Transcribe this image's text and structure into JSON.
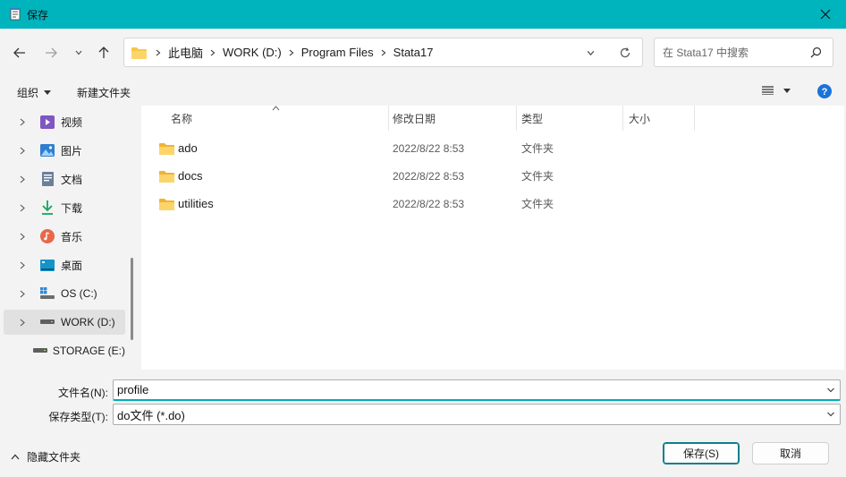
{
  "window": {
    "title": "保存"
  },
  "address": {
    "crumbs": [
      "此电脑",
      "WORK (D:)",
      "Program Files",
      "Stata17"
    ]
  },
  "search": {
    "placeholder": "在 Stata17 中搜索"
  },
  "toolbar": {
    "organize": "组织",
    "new_folder": "新建文件夹"
  },
  "sidebar": {
    "items": [
      {
        "label": "视频",
        "icon": "video-icon"
      },
      {
        "label": "图片",
        "icon": "pictures-icon"
      },
      {
        "label": "文档",
        "icon": "documents-icon"
      },
      {
        "label": "下载",
        "icon": "download-icon"
      },
      {
        "label": "音乐",
        "icon": "music-icon"
      },
      {
        "label": "桌面",
        "icon": "desktop-icon"
      },
      {
        "label": "OS (C:)",
        "icon": "windows-drive-icon"
      },
      {
        "label": "WORK (D:)",
        "icon": "drive-icon",
        "selected": true
      },
      {
        "label": "STORAGE (E:)",
        "icon": "drive-icon"
      }
    ]
  },
  "columns": {
    "name": "名称",
    "date": "修改日期",
    "type": "类型",
    "size": "大小"
  },
  "files": [
    {
      "name": "ado",
      "date": "2022/8/22 8:53",
      "type": "文件夹"
    },
    {
      "name": "docs",
      "date": "2022/8/22 8:53",
      "type": "文件夹"
    },
    {
      "name": "utilities",
      "date": "2022/8/22 8:53",
      "type": "文件夹"
    }
  ],
  "form": {
    "filename_label": "文件名(N):",
    "filename_value": "profile",
    "filetype_label": "保存类型(T):",
    "filetype_value": "do文件 (*.do)"
  },
  "footer": {
    "hide_folders": "隐藏文件夹",
    "save": "保存(S)",
    "cancel": "取消"
  },
  "colors": {
    "titlebar": "#00b4be",
    "accent": "#0f7f8a",
    "folder": "#f8c64a",
    "help": "#1a73d9"
  }
}
